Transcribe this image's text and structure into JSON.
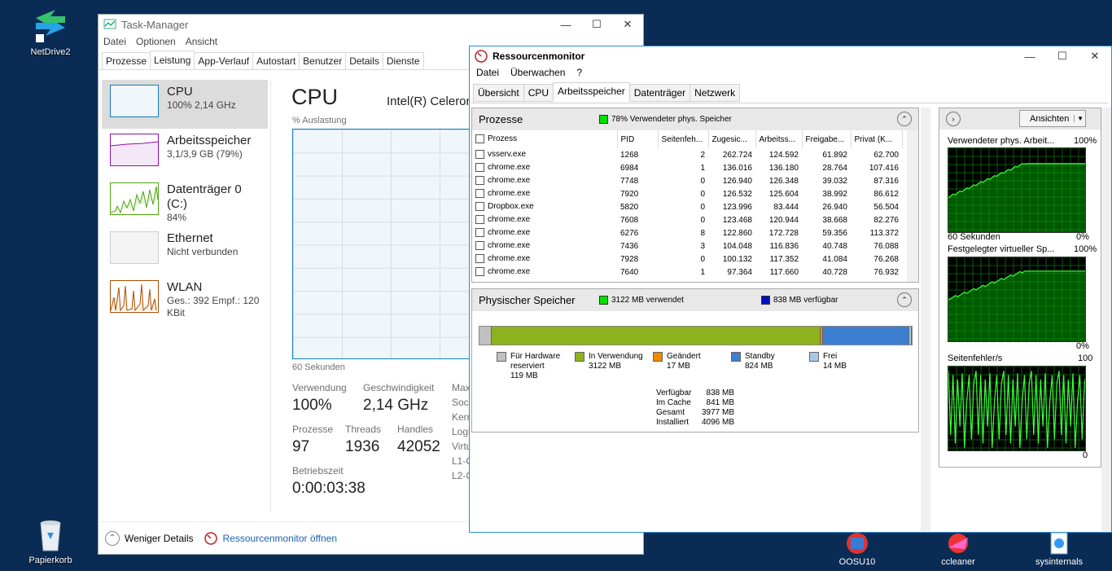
{
  "desktop": {
    "icons": [
      {
        "label": "NetDrive2",
        "icon": "netdrive-icon"
      },
      {
        "label": "Papierkorb",
        "icon": "recycle-bin-icon"
      }
    ],
    "bottom_icons": [
      {
        "label": "OOSU10",
        "icon": "oosu10-icon"
      },
      {
        "label": "ccleaner",
        "icon": "ccleaner-icon"
      },
      {
        "label": "sysinternals",
        "icon": "sysinternals-icon"
      }
    ]
  },
  "taskmanager": {
    "title": "Task-Manager",
    "menu": [
      "Datei",
      "Optionen",
      "Ansicht"
    ],
    "tabs": [
      "Prozesse",
      "Leistung",
      "App-Verlauf",
      "Autostart",
      "Benutzer",
      "Details",
      "Dienste"
    ],
    "active_tab": "Leistung",
    "resources": [
      {
        "name": "CPU",
        "sub": "100% 2,14 GHz"
      },
      {
        "name": "Arbeitsspeicher",
        "sub": "3,1/3,9 GB (79%)"
      },
      {
        "name": "Datenträger 0 (C:)",
        "sub": "84%"
      },
      {
        "name": "Ethernet",
        "sub": "Nicht verbunden"
      },
      {
        "name": "WLAN",
        "sub": "Ges.: 392  Empf.: 120 KBit"
      }
    ],
    "main": {
      "heading": "CPU",
      "cpu_name": "Intel(R) Celeron",
      "graph_label": "% Auslastung",
      "graph_time": "60 Sekunden",
      "stats": {
        "verwendung_label": "Verwendung",
        "verwendung": "100%",
        "geschwindigkeit_label": "Geschwindigkeit",
        "geschwindigkeit": "2,14 GHz",
        "prozesse_label": "Prozesse",
        "prozesse": "97",
        "threads_label": "Threads",
        "threads": "1936",
        "handles_label": "Handles",
        "handles": "42052",
        "betriebszeit_label": "Betriebszeit",
        "betriebszeit": "0:00:03:38"
      },
      "right_labels": [
        "Max",
        "Sock",
        "Kern",
        "Logi",
        "Virtu",
        "L1-C",
        "L2-C"
      ]
    },
    "footer": {
      "less_details": "Weniger Details",
      "open_resmon": "Ressourcenmonitor öffnen"
    }
  },
  "resmon": {
    "title": "Ressourcenmonitor",
    "menu": [
      "Datei",
      "Überwachen",
      "?"
    ],
    "tabs": [
      "Übersicht",
      "CPU",
      "Arbeitsspeicher",
      "Datenträger",
      "Netzwerk"
    ],
    "processes": {
      "title": "Prozesse",
      "indicator": "78% Verwendeter phys. Speicher",
      "columns": [
        "Prozess",
        "PID",
        "Seitenfeh...",
        "Zugesic...",
        "Arbeitss...",
        "Freigabe...",
        "Privat (K..."
      ],
      "rows": [
        [
          "vsserv.exe",
          "1268",
          "2",
          "262.724",
          "124.592",
          "61.892",
          "62.700"
        ],
        [
          "chrome.exe",
          "6984",
          "1",
          "136.016",
          "136.180",
          "28.764",
          "107.416"
        ],
        [
          "chrome.exe",
          "7748",
          "0",
          "126.940",
          "126.348",
          "39.032",
          "87.316"
        ],
        [
          "chrome.exe",
          "7920",
          "0",
          "126.532",
          "125.604",
          "38.992",
          "86.612"
        ],
        [
          "Dropbox.exe",
          "5820",
          "0",
          "123.996",
          "83.444",
          "26.940",
          "56.504"
        ],
        [
          "chrome.exe",
          "7608",
          "0",
          "123.468",
          "120.944",
          "38.668",
          "82.276"
        ],
        [
          "chrome.exe",
          "6276",
          "8",
          "122.860",
          "172.728",
          "59.356",
          "113.372"
        ],
        [
          "chrome.exe",
          "7436",
          "3",
          "104.048",
          "116.836",
          "40.748",
          "76.088"
        ],
        [
          "chrome.exe",
          "7928",
          "0",
          "100.132",
          "117.352",
          "41.084",
          "76.268"
        ],
        [
          "chrome.exe",
          "7640",
          "1",
          "97.364",
          "117.660",
          "40.728",
          "76.932"
        ]
      ]
    },
    "physical": {
      "title": "Physischer Speicher",
      "used": "3122 MB verwendet",
      "available": "838 MB verfügbar",
      "bar": [
        {
          "key": "hardware",
          "mb": 119,
          "color": "#c0c0c0"
        },
        {
          "key": "inuse",
          "mb": 3122,
          "color": "#8cb21d"
        },
        {
          "key": "modified",
          "mb": 17,
          "color": "#f08a00"
        },
        {
          "key": "standby",
          "mb": 824,
          "color": "#3c7fd0"
        },
        {
          "key": "free",
          "mb": 14,
          "color": "#a8c8ea"
        }
      ],
      "legend": [
        {
          "label": "Für Hardware reserviert",
          "value": "119 MB",
          "color": "#c0c0c0"
        },
        {
          "label": "In Verwendung",
          "value": "3122 MB",
          "color": "#8cb21d"
        },
        {
          "label": "Geändert",
          "value": "17 MB",
          "color": "#f08a00"
        },
        {
          "label": "Standby",
          "value": "824 MB",
          "color": "#3c7fd0"
        },
        {
          "label": "Frei",
          "value": "14 MB",
          "color": "#a8c8ea"
        }
      ],
      "summary": [
        {
          "label": "Verfügbar",
          "value": "838 MB"
        },
        {
          "label": "Im Cache",
          "value": "841 MB"
        },
        {
          "label": "Gesamt",
          "value": "3977 MB"
        },
        {
          "label": "Installiert",
          "value": "4096 MB"
        }
      ]
    },
    "graphs": {
      "views_button": "Ansichten",
      "g1_title": "Verwendeter phys. Arbeit...",
      "g1_max": "100%",
      "g1_time": "60 Sekunden",
      "g1_min": "0%",
      "g2_title": "Festgelegter virtueller Sp...",
      "g2_max": "100%",
      "g2_min": "0%",
      "g3_title": "Seitenfehler/s",
      "g3_max": "100",
      "g3_min": "0"
    }
  }
}
